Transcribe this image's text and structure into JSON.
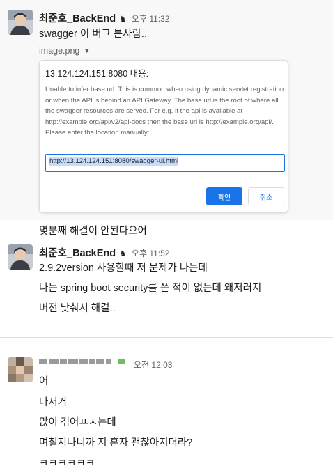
{
  "messages": [
    {
      "author": "최준호_BackEnd",
      "badge_icon": "knight-icon",
      "badge_glyph": "♞",
      "time": "오후 11:32",
      "lines": [
        "swagger 이 버그 본사람..",
        "몇분째 해결이 안된다으어"
      ],
      "attachment": {
        "file_name": "image.png",
        "dialog": {
          "title": "13.124.124.151:8080 내용:",
          "body": "Unable to infer base url. This is common when using dynamic servlet registration or when the API is behind an API Gateway. The base url is the root of where all the swagger resources are served. For e.g. if the api is available at http://example.org/api/v2/api-docs then the base url is http://example.org/api/. Please enter the location manually:",
          "input_value": "http://13.124.124.151:8080/swagger-ui.html",
          "ok_label": "확인",
          "cancel_label": "취소"
        }
      }
    },
    {
      "author": "최준호_BackEnd",
      "badge_icon": "knight-icon",
      "badge_glyph": "♞",
      "time": "오후 11:52",
      "lines": [
        "2.9.2version 사용할때 저 문제가 나는데",
        "나는 spring boot security를 쓴 적이 없는데 왜저러지",
        "버전 낮춰서 해결.."
      ]
    },
    {
      "author_redacted": true,
      "time": "오전 12:03",
      "lines": [
        "어",
        "나저거",
        "많이 겪어ㅛㅅ는데",
        "며칠지나니까 지 혼자 괜찮아지더라?",
        "ㅋㅋㅋㅋㅋㅋ"
      ]
    }
  ],
  "colors": {
    "highlight_bg": "#f8f8f8",
    "primary_button": "#1a73e8",
    "selection": "#c6dcfb"
  }
}
